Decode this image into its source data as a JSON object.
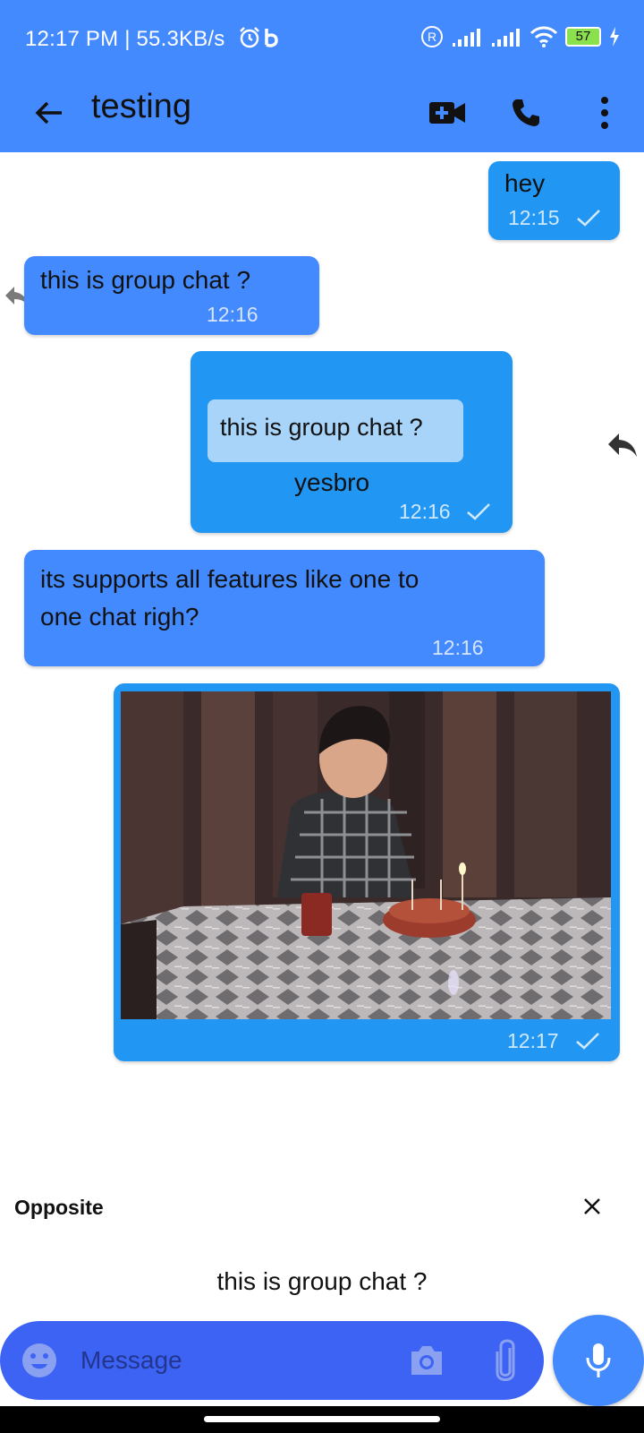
{
  "status_bar": {
    "time": "12:17 PM | 55.3KB/s",
    "battery": "57",
    "icons": [
      "alarm-icon",
      "b-app-icon",
      "registered-icon",
      "signal-icon",
      "signal-icon",
      "wifi-icon",
      "battery-icon",
      "charging-icon"
    ]
  },
  "header": {
    "title": "testing",
    "actions": [
      "video-call-icon",
      "phone-icon",
      "more-vert-icon"
    ]
  },
  "messages": [
    {
      "direction": "outgoing",
      "text": "hey",
      "time": "12:15",
      "status": "sent"
    },
    {
      "direction": "incoming",
      "text": "this is group chat ?",
      "time": "12:16"
    },
    {
      "direction": "outgoing",
      "reply_to": "this is group chat ?",
      "text": "yesbro",
      "time": "12:16",
      "status": "sent"
    },
    {
      "direction": "incoming",
      "text_line1": "its supports all features like one to",
      "text_line2": "one chat righ?",
      "time": "12:16"
    },
    {
      "direction": "outgoing",
      "media": "photo: child with birthday cake",
      "time": "12:17",
      "status": "sent"
    }
  ],
  "reply_preview": {
    "sender": "Opposite",
    "text": "this is group chat ?"
  },
  "composer": {
    "placeholder": "Message"
  },
  "colors": {
    "app_bar": "#448aff",
    "outgoing_bubble": "#2196f3",
    "incoming_bubble": "#448aff",
    "quote_bg": "#a8d4fa",
    "input_bar": "#3d63f5"
  }
}
